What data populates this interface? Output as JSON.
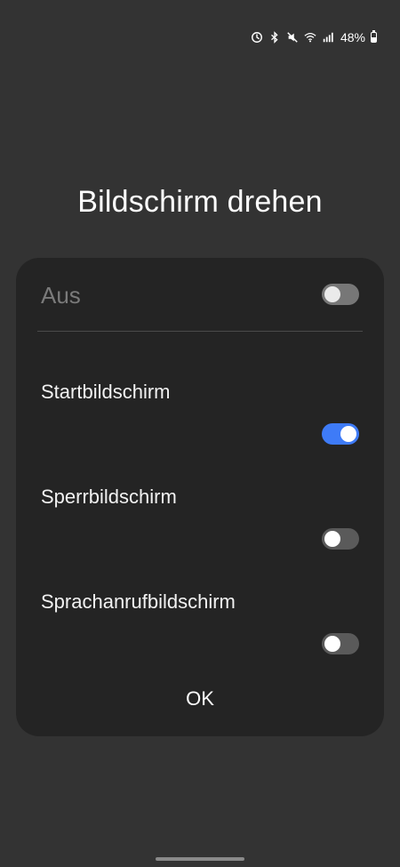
{
  "status_bar": {
    "icons": [
      "data-saver-icon",
      "bluetooth-icon",
      "mute-icon",
      "wifi-icon",
      "signal-icon"
    ],
    "battery": "48%"
  },
  "dialog": {
    "title": "Bildschirm drehen",
    "off_option": {
      "label": "Aus",
      "enabled": false
    },
    "options": [
      {
        "label": "Startbildschirm",
        "enabled": true
      },
      {
        "label": "Sperrbildschirm",
        "enabled": false
      },
      {
        "label": "Sprachanrufbildschirm",
        "enabled": false
      }
    ],
    "ok_label": "OK"
  },
  "colors": {
    "background": "#333333",
    "dialog": "#242424",
    "accent": "#3e7bf7"
  }
}
